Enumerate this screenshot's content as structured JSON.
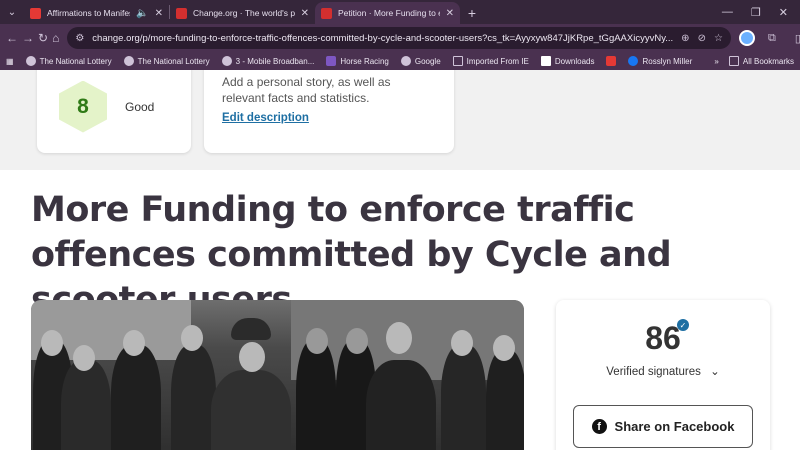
{
  "tabs": [
    {
      "title": "Affirmations to Manifest Gr",
      "fav_color": "#e53935",
      "active": false
    },
    {
      "title": "Change.org · The world's platfo",
      "fav_color": "#d32f2f",
      "active": false
    },
    {
      "title": "Petition · More Funding to enfo",
      "fav_color": "#d32f2f",
      "active": true
    }
  ],
  "address_bar": {
    "url": "change.org/p/more-funding-to-enforce-traffic-offences-committed-by-cycle-and-scooter-users?cs_tk=Ayyxyw847JjKRpe_tGgAAXicyyvNy..."
  },
  "bookmarks": [
    {
      "label": "The National Lottery",
      "icon": "lottery-icon"
    },
    {
      "label": "The National Lottery",
      "icon": "lottery-icon"
    },
    {
      "label": "3 - Mobile Broadban...",
      "icon": "three-icon"
    },
    {
      "label": "Horse Racing",
      "icon": "betfair-icon"
    },
    {
      "label": "Google",
      "icon": "google-icon"
    },
    {
      "label": "Imported From IE",
      "icon": "folder-icon"
    },
    {
      "label": "Downloads",
      "icon": "page-icon"
    },
    {
      "label": "",
      "icon": "youtube-icon"
    },
    {
      "label": "Rosslyn Miller",
      "icon": "facebook-icon"
    }
  ],
  "bookmarks_all": "All Bookmarks",
  "strength": {
    "score": "8",
    "label": "Good"
  },
  "description": {
    "text": "Add a personal story, as well as relevant facts and statistics.",
    "edit_link": "Edit description"
  },
  "petition": {
    "title": "More Funding to enforce traffic offences committed by Cycle and scooter users"
  },
  "signatures": {
    "count": "86",
    "label": "Verified signatures",
    "share_button": "Share on Facebook"
  }
}
